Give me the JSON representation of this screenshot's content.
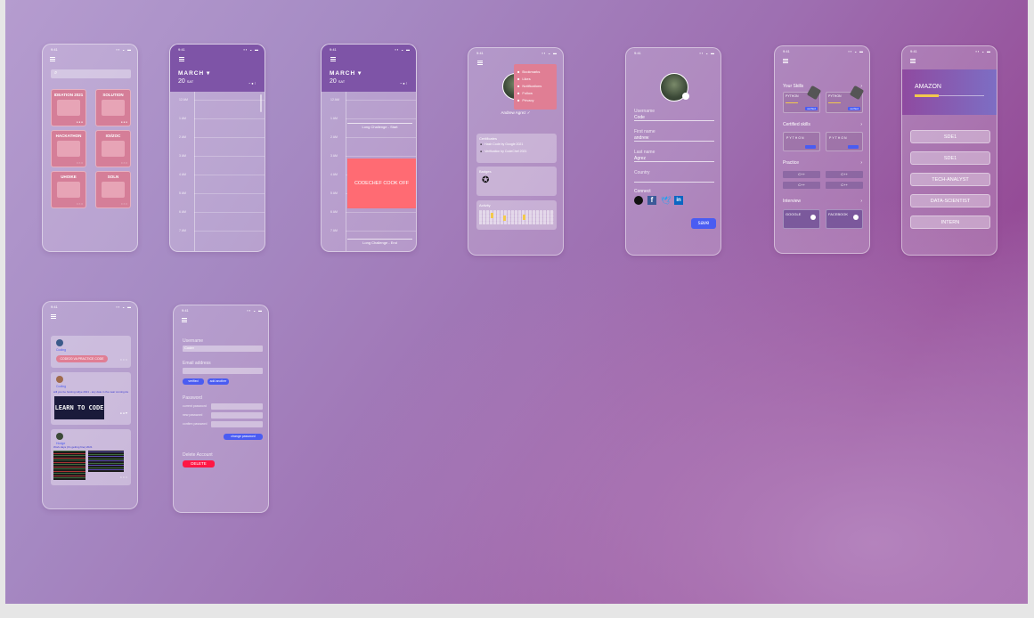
{
  "status": {
    "time": "9:41",
    "icons": "▪▪ ◒ ▬"
  },
  "events_screen": {
    "cards": [
      {
        "title": "IDEATION 2021",
        "footer": "● ● ●"
      },
      {
        "title": "SOLUTION",
        "footer": "● ● ●"
      },
      {
        "title": "HACKATHON",
        "footer": "○ ○ ○"
      },
      {
        "title": "IOI/ZOC",
        "footer": "○ ○ ○"
      },
      {
        "title": "UHOIKE",
        "footer": "○ ○ ○"
      },
      {
        "title": "SOLN",
        "footer": "○ ○ ○"
      }
    ]
  },
  "calendar_blank": {
    "month": "MARCH",
    "day_num": "20",
    "day_name": "SAT",
    "hours": [
      "12 AM",
      "1 AM",
      "2 AM",
      "3 AM",
      "4 AM",
      "5 AM",
      "6 AM",
      "7 AM"
    ]
  },
  "calendar_event": {
    "month": "MARCH",
    "day_num": "20",
    "day_name": "SAT",
    "hours": [
      "12 AM",
      "1 AM",
      "2 AM",
      "3 AM",
      "4 AM",
      "5 AM",
      "6 AM",
      "7 AM"
    ],
    "start_label": "Long Challenge - Start",
    "event_label": "CODECHEF COOK OFF",
    "end_label": "Long Challenge - End"
  },
  "profile_menu": {
    "name": "Andrew Agrez ✓",
    "menu": [
      "Bookmarks",
      "Likes",
      "Notifications",
      "Follow",
      "Privacy"
    ],
    "certificates_label": "Certificates",
    "certificates": [
      "Hash Code by Google 2021",
      "Verification by CodeChef 2021"
    ],
    "badges_label": "Badges",
    "activity_label": "Activity"
  },
  "edit_profile": {
    "username_label": "Username",
    "username_value": "Code",
    "firstname_label": "First name",
    "firstname_value": "andrew",
    "lastname_label": "Last name",
    "lastname_value": "Agrez",
    "country_label": "Country",
    "connect_label": "Connect",
    "save_label": "save"
  },
  "skills_screen": {
    "your_skills": "Your Skills",
    "certified": "Certified skills",
    "practice": "Practice",
    "interview": "Interview",
    "skill_name": "PYTHON",
    "btn_small": "verified",
    "practice_items": [
      "C++",
      "C++",
      "C++",
      "C++"
    ],
    "companies": [
      "GOOGLE",
      "FACEBOOK"
    ]
  },
  "roles_screen": {
    "company": "AMAZON",
    "progress": 0.35,
    "roles": [
      "SDE1",
      "SDE1",
      "TECH-ANALYST",
      "DATA-SCIENTIST",
      "INTERN"
    ]
  },
  "feed_screen": {
    "posts": [
      {
        "user": "Coding",
        "button": "CODE20 VA PRACTICE CODE"
      },
      {
        "user": "Coding",
        "text": "will you be hosting rallye 2021 - any date in the near coming days?",
        "image_text": "LEARN TO CODE"
      },
      {
        "user": "Hodge",
        "text": "Work days (it's getting fine) 2021"
      }
    ]
  },
  "settings_screen": {
    "username_label": "Username",
    "username_value": "Coder",
    "email_label": "Email address",
    "verify_btn": "verified",
    "add_btn": "add another",
    "password_label": "Password",
    "pw_fields": [
      "current password",
      "new password",
      "confirm password"
    ],
    "change_btn": "change password",
    "delete_label": "Delete Account",
    "delete_btn": "DELETE"
  },
  "colors": {
    "accent": "#4a5cf2",
    "calendar_header": "#7e54a7",
    "event": "#ff6b73",
    "delete": "#ff1744"
  }
}
